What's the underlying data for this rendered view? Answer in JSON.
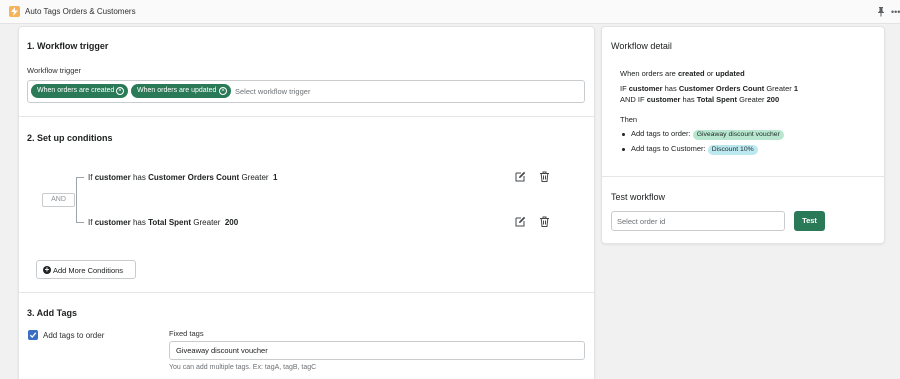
{
  "app": {
    "title": "Auto Tags Orders & Customers",
    "icons": {
      "app": "bolt-icon",
      "pin": "pin-icon",
      "more": "more-horizontal-icon"
    }
  },
  "colors": {
    "primary": "#2a7a58",
    "checkbox": "#3a6fc4",
    "order_tag_bg": "#b8e6cf",
    "customer_tag_bg": "#bce8f0"
  },
  "trigger": {
    "section_title": "1. Workflow trigger",
    "field_label": "Workflow trigger",
    "chips": [
      "When orders are created",
      "When orders are updated"
    ],
    "placeholder": "Select workflow trigger"
  },
  "conditions": {
    "section_title": "2. Set up conditions",
    "operator": "AND",
    "rows": [
      {
        "prefix": "If",
        "entity": "customer",
        "verb": "has",
        "field": "Customer Orders Count",
        "comparator": "Greater",
        "value": "1"
      },
      {
        "prefix": "If",
        "entity": "customer",
        "verb": "has",
        "field": "Total Spent",
        "comparator": "Greater",
        "value": "200"
      }
    ],
    "row_icons": [
      "edit-icon",
      "trash-icon"
    ],
    "add_more_label": "Add More Conditions"
  },
  "tags": {
    "section_title": "3. Add Tags",
    "checkbox_label": "Add tags to order",
    "checkbox_checked": true,
    "fixed_tags_label": "Fixed tags",
    "fixed_tags_value": "Giveaway discount voucher",
    "help_text": "You can add multiple tags. Ex: tagA, tagB, tagC"
  },
  "detail": {
    "title": "Workflow detail",
    "line1": {
      "a": "When orders are",
      "b": "created",
      "c": "or",
      "d": "updated"
    },
    "line2": {
      "a": "IF",
      "b": "customer",
      "c": "has",
      "d": "Customer Orders Count",
      "e": "Greater",
      "f": "1"
    },
    "line3": {
      "a": "AND IF",
      "b": "customer",
      "c": "has",
      "d": "Total Spent",
      "e": "Greater",
      "f": "200"
    },
    "then_label": "Then",
    "actions": [
      {
        "text": "Add tags to order:",
        "tag": "Giveaway discount voucher"
      },
      {
        "text": "Add tags to Customer:",
        "tag": "Discount 10%"
      }
    ]
  },
  "test": {
    "title": "Test workflow",
    "placeholder": "Select order id",
    "button_label": "Test"
  }
}
